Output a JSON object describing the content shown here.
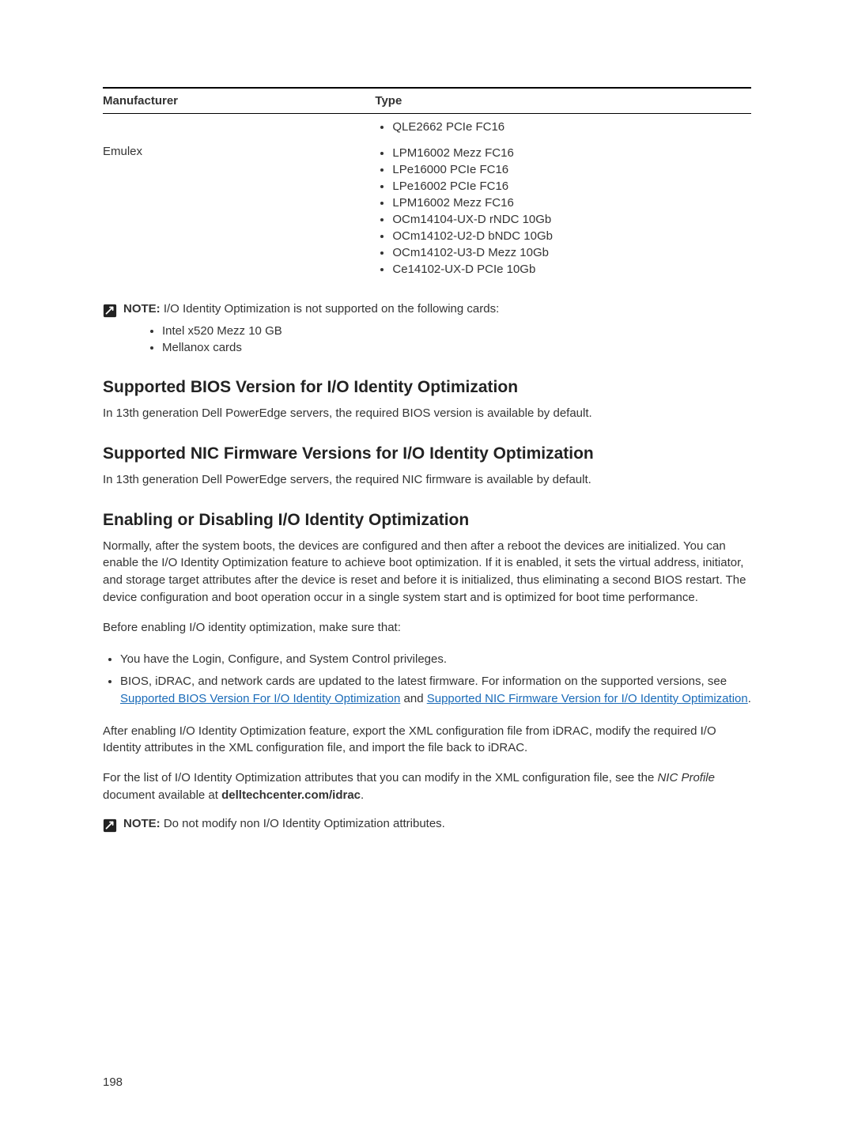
{
  "table": {
    "headers": {
      "col1": "Manufacturer",
      "col2": "Type"
    },
    "row0": {
      "mfr": "",
      "types": [
        "QLE2662 PCIe FC16"
      ]
    },
    "row1": {
      "mfr": "Emulex",
      "types": [
        "LPM16002 Mezz FC16",
        "LPe16000 PCIe FC16",
        "LPe16002 PCIe FC16",
        "LPM16002 Mezz FC16",
        "OCm14104-UX-D rNDC 10Gb",
        "OCm14102-U2-D bNDC 10Gb",
        "OCm14102-U3-D Mezz 10Gb",
        "Ce14102-UX-D PCIe 10Gb"
      ]
    }
  },
  "note1": {
    "label": "NOTE: ",
    "text": "I/O Identity Optimization is not supported on the following cards:",
    "items": [
      "Intel x520 Mezz 10 GB",
      "Mellanox cards"
    ]
  },
  "section1": {
    "heading": "Supported BIOS Version for I/O Identity Optimization",
    "p1": "In 13th generation Dell PowerEdge servers, the required BIOS version is available by default."
  },
  "section2": {
    "heading": "Supported NIC Firmware Versions for I/O Identity Optimization",
    "p1": "In 13th generation Dell PowerEdge servers, the required NIC firmware is available by default."
  },
  "section3": {
    "heading": "Enabling or Disabling I/O Identity Optimization",
    "p1": "Normally, after the system boots, the devices are configured and then after a reboot the devices are initialized. You can enable the I/O Identity Optimization feature to achieve boot optimization. If it is enabled, it sets the virtual address, initiator, and storage target attributes after the device is reset and before it is initialized, thus eliminating a second BIOS restart. The device configuration and boot operation occur in a single system start and is optimized for boot time performance.",
    "p2": "Before enabling I/O identity optimization, make sure that:",
    "bullets": {
      "b1": "You have the Login, Configure, and System Control privileges.",
      "b2_pre": "BIOS, iDRAC, and network cards are updated to the latest firmware. For information on the supported versions, see ",
      "b2_link1": "Supported BIOS Version For I/O Identity Optimization",
      "b2_mid": " and ",
      "b2_link2": "Supported NIC Firmware Version for I/O Identity Optimization",
      "b2_post": "."
    },
    "p3": "After enabling I/O Identity Optimization feature, export the XML configuration file from iDRAC, modify the required I/O Identity attributes in the XML configuration file, and import the file back to iDRAC.",
    "p4_pre": "For the list of I/O Identity Optimization attributes that you can modify in the XML configuration file, see the ",
    "p4_em": "NIC Profile",
    "p4_mid": " document available at ",
    "p4_bold": "delltechcenter.com/idrac",
    "p4_post": "."
  },
  "note2": {
    "label": "NOTE: ",
    "text": "Do not modify non I/O Identity Optimization attributes."
  },
  "pageNumber": "198"
}
